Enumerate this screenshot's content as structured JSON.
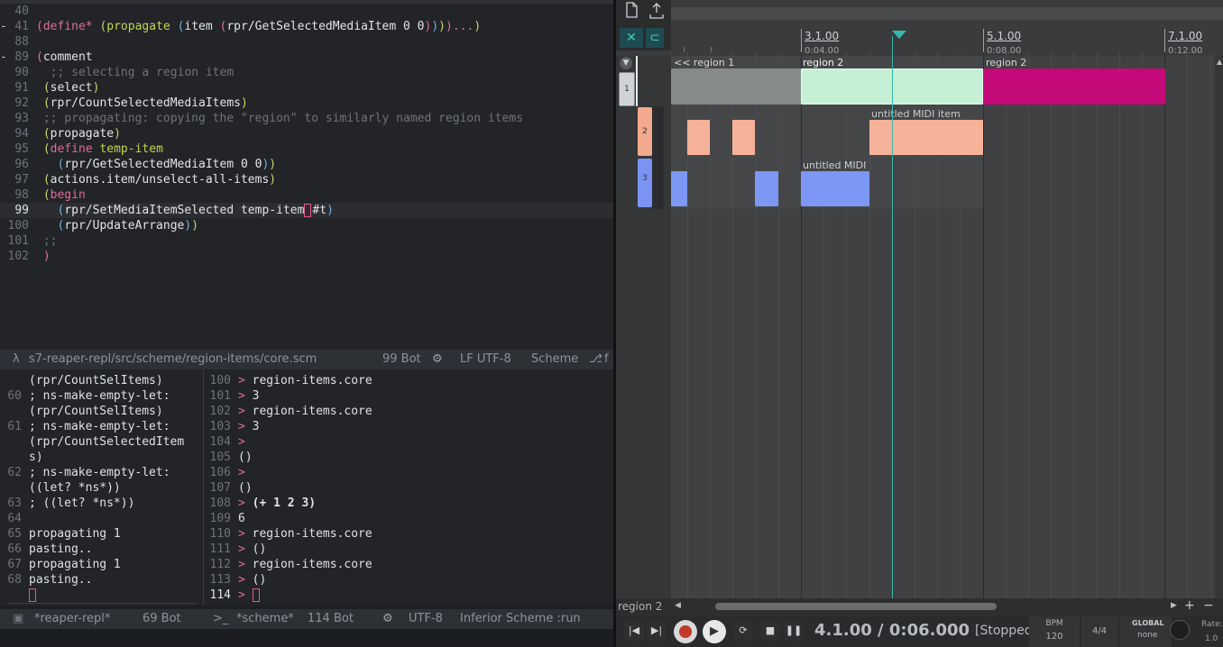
{
  "editor": {
    "lines": [
      {
        "num": "40",
        "fold": "",
        "segs": []
      },
      {
        "num": "41",
        "fold": "-",
        "segs": [
          [
            "c-par",
            "("
          ],
          [
            "c-kw",
            "define*"
          ],
          [
            "c-fn",
            " "
          ],
          [
            "c-b1",
            "("
          ],
          [
            "c-def",
            "propagate"
          ],
          [
            "c-fn",
            " "
          ],
          [
            "c-b2",
            "("
          ],
          [
            "c-fn",
            "item "
          ],
          [
            "c-par",
            "("
          ],
          [
            "c-fn",
            "rpr/GetSelectedMediaItem 0 0"
          ],
          [
            "c-par",
            ")"
          ],
          [
            "c-b2",
            ")"
          ],
          [
            "c-b1",
            ")"
          ],
          [
            "c-par",
            ")..."
          ],
          [
            "c-b1",
            ")"
          ]
        ]
      },
      {
        "num": "88",
        "fold": "",
        "segs": []
      },
      {
        "num": "89",
        "fold": "-",
        "segs": [
          [
            "c-par",
            "("
          ],
          [
            "c-fn",
            "comment"
          ]
        ]
      },
      {
        "num": "90",
        "fold": "",
        "segs": [
          [
            "c-cm",
            "  ;; selecting a region item"
          ]
        ]
      },
      {
        "num": "91",
        "fold": "",
        "segs": [
          [
            "c-fn",
            " "
          ],
          [
            "c-b1",
            "("
          ],
          [
            "c-fn",
            "select"
          ],
          [
            "c-b1",
            ")"
          ]
        ]
      },
      {
        "num": "92",
        "fold": "",
        "segs": [
          [
            "c-fn",
            " "
          ],
          [
            "c-b1",
            "("
          ],
          [
            "c-fn",
            "rpr/CountSelectedMediaItems"
          ],
          [
            "c-b1",
            ")"
          ]
        ]
      },
      {
        "num": "93",
        "fold": "",
        "segs": [
          [
            "c-cm",
            " ;; propagating: copying the \"region\" to similarly named region items"
          ]
        ]
      },
      {
        "num": "94",
        "fold": "",
        "segs": [
          [
            "c-fn",
            " "
          ],
          [
            "c-b1",
            "("
          ],
          [
            "c-fn",
            "propagate"
          ],
          [
            "c-b1",
            ")"
          ]
        ]
      },
      {
        "num": "95",
        "fold": "",
        "segs": [
          [
            "c-fn",
            " "
          ],
          [
            "c-b1",
            "("
          ],
          [
            "c-kw",
            "define"
          ],
          [
            "c-fn",
            " "
          ],
          [
            "c-def",
            "temp-item"
          ]
        ]
      },
      {
        "num": "96",
        "fold": "",
        "segs": [
          [
            "c-fn",
            "   "
          ],
          [
            "c-b2",
            "("
          ],
          [
            "c-fn",
            "rpr/GetSelectedMediaItem 0 0"
          ],
          [
            "c-b2",
            ")"
          ],
          [
            "c-b1",
            ")"
          ]
        ]
      },
      {
        "num": "97",
        "fold": "",
        "segs": [
          [
            "c-fn",
            " "
          ],
          [
            "c-b1",
            "("
          ],
          [
            "c-fn",
            "actions.item/unselect-all-items"
          ],
          [
            "c-b1",
            ")"
          ]
        ]
      },
      {
        "num": "98",
        "fold": "",
        "segs": [
          [
            "c-fn",
            " "
          ],
          [
            "c-b1",
            "("
          ],
          [
            "c-kw",
            "begin"
          ]
        ]
      },
      {
        "num": "99",
        "fold": "",
        "cur": true,
        "segs": [
          [
            "c-fn",
            "   "
          ],
          [
            "c-b2",
            "("
          ],
          [
            "c-fn",
            "rpr/SetMediaItemSelected temp-item"
          ],
          [
            "cursor",
            ""
          ],
          [
            "c-fn",
            "#t"
          ],
          [
            "c-b2",
            ")"
          ]
        ]
      },
      {
        "num": "100",
        "fold": "",
        "segs": [
          [
            "c-fn",
            "   "
          ],
          [
            "c-b2",
            "("
          ],
          [
            "c-fn",
            "rpr/UpdateArrange"
          ],
          [
            "c-b2",
            ")"
          ],
          [
            "c-b1",
            ")"
          ]
        ]
      },
      {
        "num": "101",
        "fold": "",
        "segs": [
          [
            "c-cm",
            " ;;"
          ]
        ]
      },
      {
        "num": "102",
        "fold": "",
        "segs": [
          [
            "c-par",
            " )"
          ]
        ]
      }
    ]
  },
  "modeline_top": {
    "lambda": "λ",
    "path": "s7-reaper-repl/src/scheme/region-items/core.scm",
    "pos": "99 Bot",
    "gear": "⚙",
    "enc": "LF UTF-8",
    "mode": "Scheme",
    "vc": "f"
  },
  "repl_left": {
    "lines": [
      {
        "n": "",
        "t": "(rpr/CountSelItems)"
      },
      {
        "n": "60",
        "t": "; ns-make-empty-let:"
      },
      {
        "n": "",
        "t": "(rpr/CountSelItems)"
      },
      {
        "n": "61",
        "t": "; ns-make-empty-let:"
      },
      {
        "n": "",
        "t": "(rpr/CountSelectedItem"
      },
      {
        "n": "",
        "t": "s)"
      },
      {
        "n": "62",
        "t": "; ns-make-empty-let:"
      },
      {
        "n": "",
        "t": "((let? *ns*))"
      },
      {
        "n": "63",
        "t": "; ((let? *ns*))"
      },
      {
        "n": "64",
        "t": ""
      },
      {
        "n": "65",
        "t": "propagating 1"
      },
      {
        "n": "66",
        "t": "pasting.."
      },
      {
        "n": "67",
        "t": "propagating 1"
      },
      {
        "n": "68",
        "t": "pasting.."
      },
      {
        "n": "",
        "t": "",
        "cursor": true
      }
    ]
  },
  "repl_right": {
    "lines": [
      {
        "n": "100",
        "p": ">",
        "t": "region-items.core"
      },
      {
        "n": "101",
        "p": ">",
        "t": "3"
      },
      {
        "n": "102",
        "p": ">",
        "t": "region-items.core"
      },
      {
        "n": "103",
        "p": ">",
        "t": "3"
      },
      {
        "n": "104",
        "p": ">",
        "t": ""
      },
      {
        "n": "105",
        "p": "",
        "t": "()"
      },
      {
        "n": "106",
        "p": ">",
        "t": ""
      },
      {
        "n": "107",
        "p": "",
        "t": "()"
      },
      {
        "n": "108",
        "p": ">",
        "t": "(+ 1 2 3)",
        "bold": true
      },
      {
        "n": "109",
        "p": "",
        "t": "6"
      },
      {
        "n": "110",
        "p": ">",
        "t": "region-items.core"
      },
      {
        "n": "111",
        "p": ">",
        "t": "()"
      },
      {
        "n": "112",
        "p": ">",
        "t": "region-items.core"
      },
      {
        "n": "113",
        "p": ">",
        "t": "()"
      },
      {
        "n": "114",
        "p": ">",
        "t": "",
        "cursor": true
      }
    ]
  },
  "modeline_bottom": {
    "buf1": "*reaper-repl*",
    "pos1": "69 Bot",
    "buf2": "*scheme*",
    "pos2": "114 Bot",
    "gear": "⚙",
    "enc": "UTF-8",
    "mode": "Inferior Scheme :run"
  },
  "reaper": {
    "ruler": [
      {
        "label": "3.1.00",
        "time": "0:04.00"
      },
      {
        "label": "5.1.00",
        "time": "0:08.00"
      },
      {
        "label": "7.1.00",
        "time": "0:12.00"
      }
    ],
    "regions": [
      "<< region 1",
      "region 2",
      "region 2"
    ],
    "tracks": [
      "1",
      "2",
      "3"
    ],
    "item_labels": [
      "untitled MIDI item",
      "untitled MIDI"
    ],
    "current_region": "region 2",
    "position": "4.1.00 / 0:06.000",
    "status": "[Stopped]",
    "bpm_label": "BPM",
    "bpm": "120",
    "timesig": "4/4",
    "global_label": "GLOBAL",
    "global_value": "none",
    "rate_label": "Rate:",
    "rate": "1.0"
  }
}
